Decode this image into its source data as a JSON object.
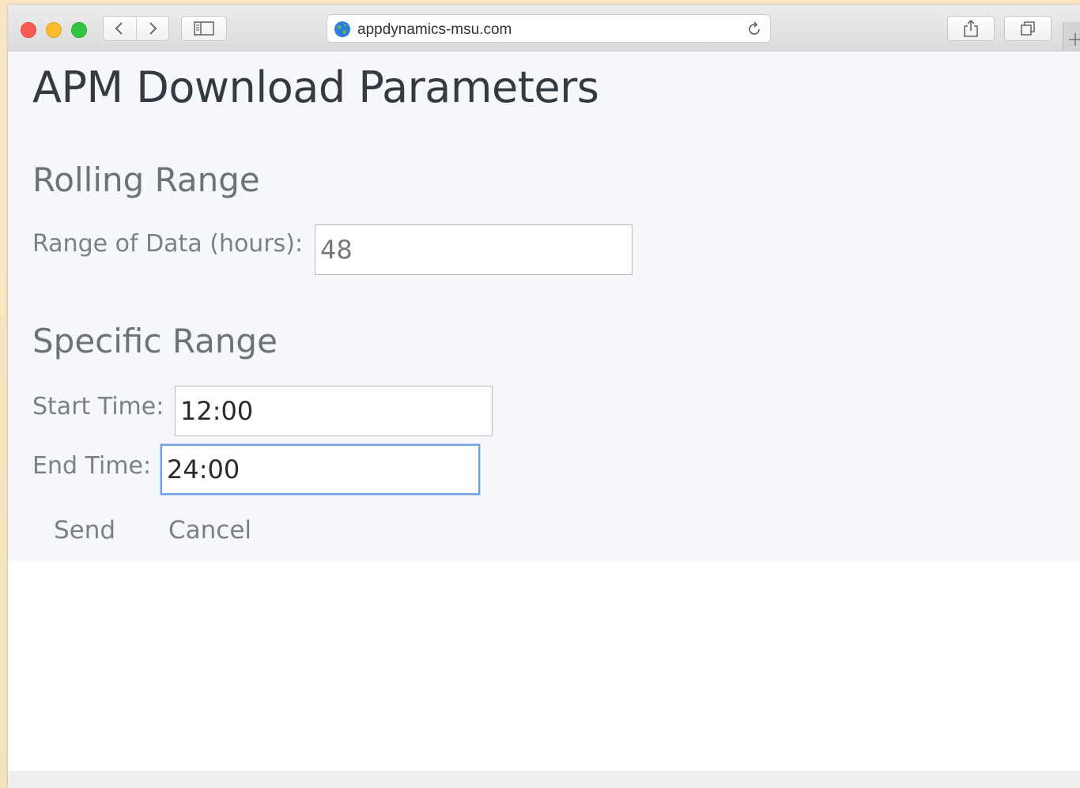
{
  "browser": {
    "url": "appdynamics-msu.com",
    "icons": {
      "back": "chevron-left-icon",
      "forward": "chevron-right-icon",
      "sidebar": "sidebar-icon",
      "site": "globe-icon",
      "reload": "reload-icon",
      "share": "share-icon",
      "tabs": "tabs-overview-icon",
      "new_tab": "plus-icon"
    }
  },
  "page": {
    "title": "APM Download Parameters",
    "rolling_range": {
      "heading": "Rolling Range",
      "range_label": "Range of Data (hours):",
      "range_value": "48"
    },
    "specific_range": {
      "heading": "Specific Range",
      "start_label": "Start Time:",
      "start_value": "12:00",
      "end_label": "End Time:",
      "end_value": "24:00"
    },
    "actions": {
      "send_label": "Send",
      "cancel_label": "Cancel"
    }
  },
  "colors": {
    "focus_ring": "#6fa0e6",
    "heading_text": "#333a42",
    "label_text": "#7a8086",
    "content_bg": "#f5f7fa"
  }
}
